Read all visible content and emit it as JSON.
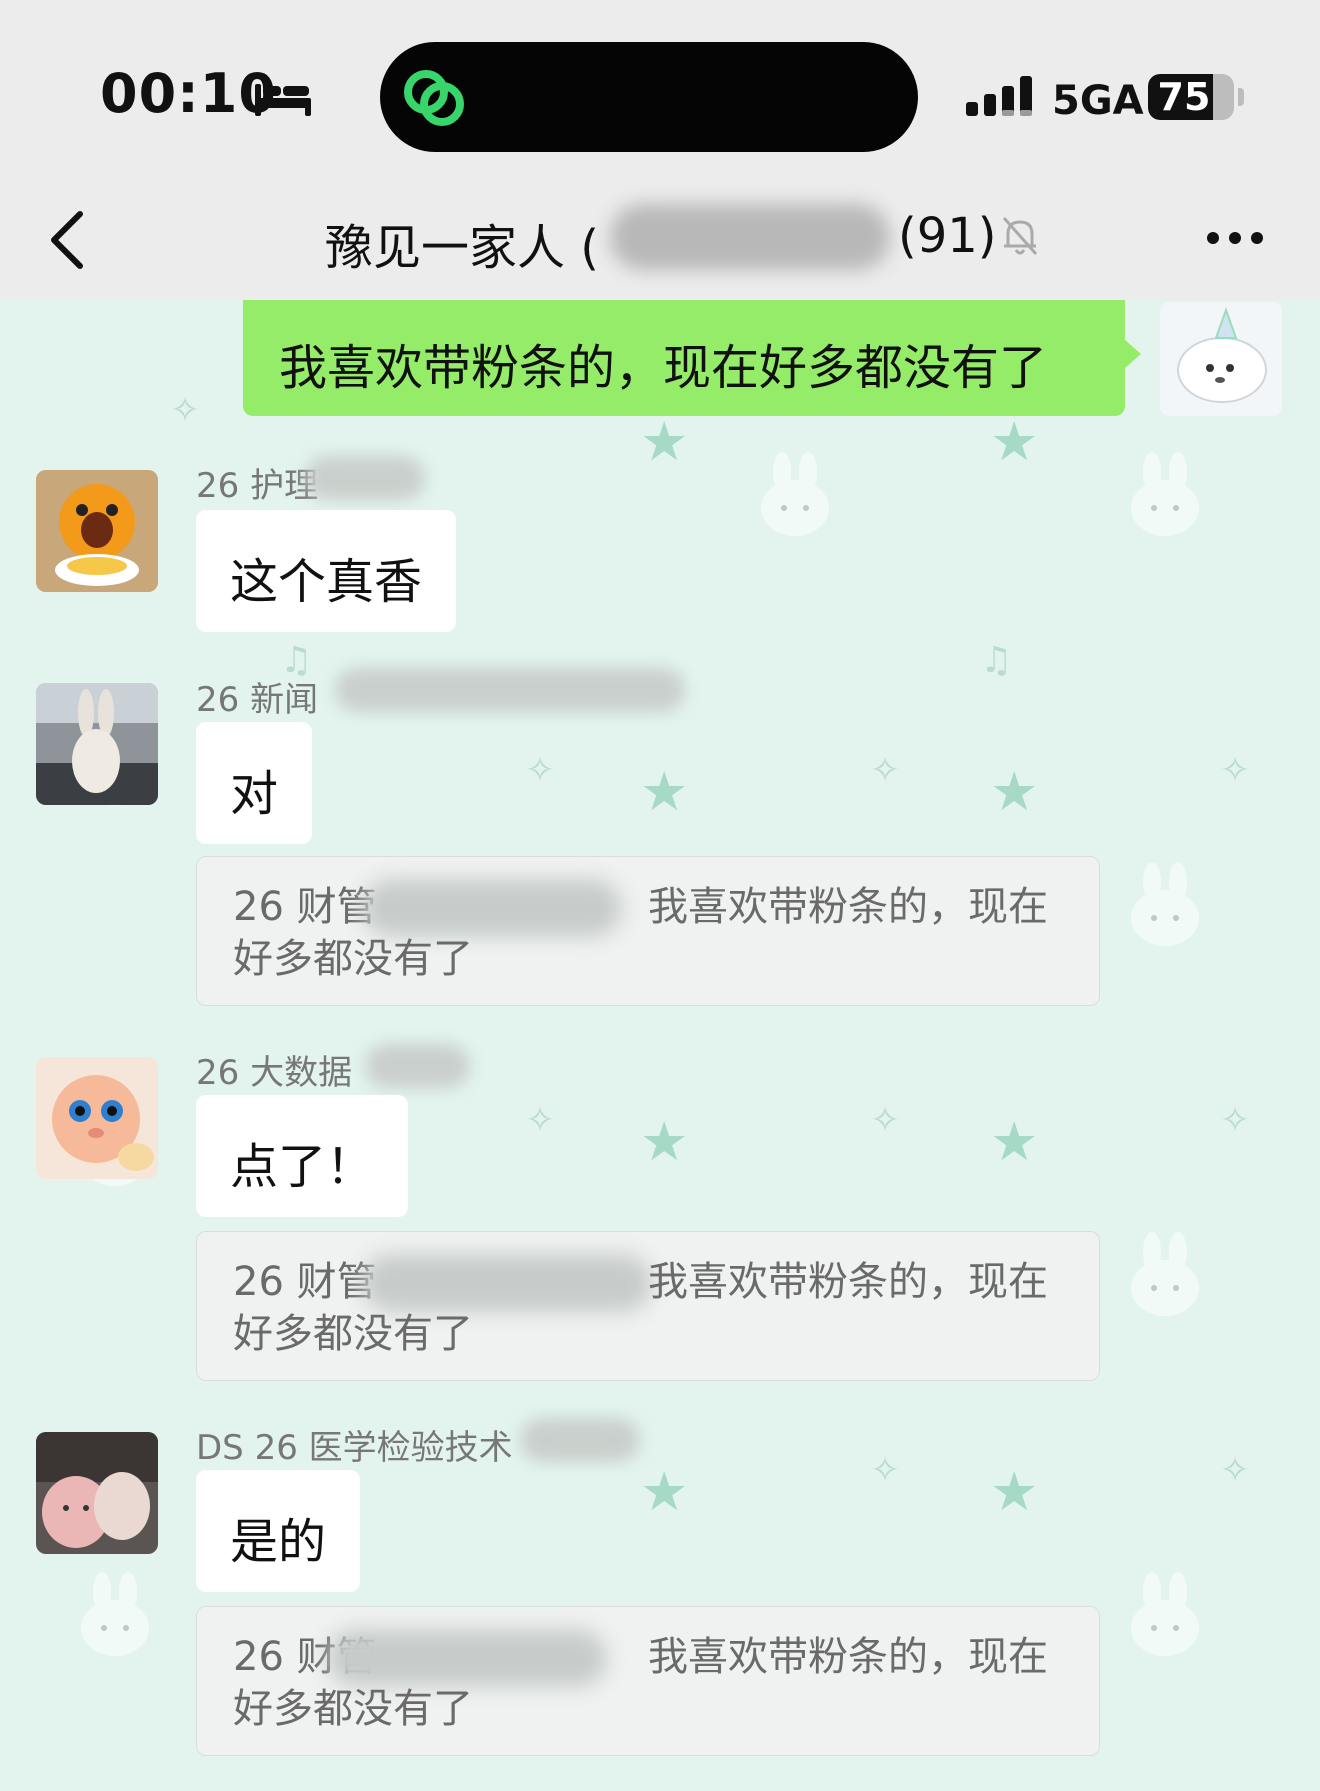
{
  "status_bar": {
    "time": "00:10",
    "network": "5GA",
    "battery_percent": 75,
    "battery_label": "75"
  },
  "nav": {
    "title": "豫见一家人 (",
    "member_count": "(91)"
  },
  "outgoing": {
    "text": "我喜欢带粉条的，现在好多都没有了"
  },
  "messages": [
    {
      "sender": "26 护理",
      "text": "这个真香"
    },
    {
      "sender": "26 新闻",
      "text": "对",
      "quote": {
        "name": "26 财管",
        "line1": "我喜欢带粉条的，现在",
        "line2": "好多都没有了"
      }
    },
    {
      "sender": "26 大数据",
      "text": "点了！",
      "quote": {
        "name": "26 财管",
        "line1": "我喜欢带粉条的，现在",
        "line2": "好多都没有了"
      }
    },
    {
      "sender": "DS 26 医学检验技术",
      "text": "是的",
      "quote": {
        "name": "26 财管",
        "line1": "我喜欢带粉条的，现在",
        "line2": "好多都没有了"
      }
    }
  ],
  "colors": {
    "outgoing_bubble": "#95ec69",
    "chat_background": "#e3f4ef",
    "bar_background": "#ececec"
  },
  "icons": [
    "bed-icon",
    "app-logo-icon",
    "signal-icon",
    "back-icon",
    "mute-bell-icon",
    "more-icon"
  ]
}
